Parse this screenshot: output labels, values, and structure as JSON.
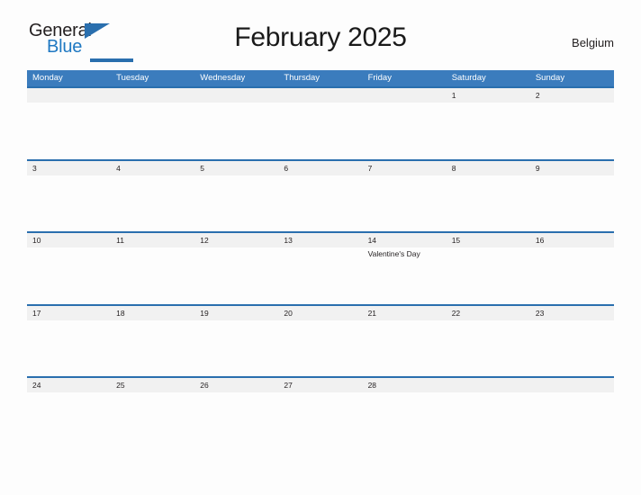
{
  "brand": {
    "name_part1": "General",
    "name_part2": "Blue",
    "flag_icon": "blue-triangle-flag-icon",
    "primary_color": "#2a6fae",
    "accent_color": "#1e78c2",
    "text_color": "#231f20"
  },
  "header": {
    "title": "February 2025",
    "region": "Belgium"
  },
  "colors": {
    "weekday_header_bg": "#3b7cbd",
    "weekday_header_text": "#ffffff",
    "week_rule": "#2a6fae",
    "date_band_bg": "#f1f1f1",
    "page_bg": "#fdfdfd"
  },
  "calendar": {
    "month": "February",
    "year": "2025",
    "weekday_headers": [
      "Monday",
      "Tuesday",
      "Wednesday",
      "Thursday",
      "Friday",
      "Saturday",
      "Sunday"
    ],
    "weeks": [
      {
        "days": [
          {
            "num": "",
            "event": ""
          },
          {
            "num": "",
            "event": ""
          },
          {
            "num": "",
            "event": ""
          },
          {
            "num": "",
            "event": ""
          },
          {
            "num": "",
            "event": ""
          },
          {
            "num": "1",
            "event": ""
          },
          {
            "num": "2",
            "event": ""
          }
        ]
      },
      {
        "days": [
          {
            "num": "3",
            "event": ""
          },
          {
            "num": "4",
            "event": ""
          },
          {
            "num": "5",
            "event": ""
          },
          {
            "num": "6",
            "event": ""
          },
          {
            "num": "7",
            "event": ""
          },
          {
            "num": "8",
            "event": ""
          },
          {
            "num": "9",
            "event": ""
          }
        ]
      },
      {
        "days": [
          {
            "num": "10",
            "event": ""
          },
          {
            "num": "11",
            "event": ""
          },
          {
            "num": "12",
            "event": ""
          },
          {
            "num": "13",
            "event": ""
          },
          {
            "num": "14",
            "event": "Valentine's Day"
          },
          {
            "num": "15",
            "event": ""
          },
          {
            "num": "16",
            "event": ""
          }
        ]
      },
      {
        "days": [
          {
            "num": "17",
            "event": ""
          },
          {
            "num": "18",
            "event": ""
          },
          {
            "num": "19",
            "event": ""
          },
          {
            "num": "20",
            "event": ""
          },
          {
            "num": "21",
            "event": ""
          },
          {
            "num": "22",
            "event": ""
          },
          {
            "num": "23",
            "event": ""
          }
        ]
      },
      {
        "days": [
          {
            "num": "24",
            "event": ""
          },
          {
            "num": "25",
            "event": ""
          },
          {
            "num": "26",
            "event": ""
          },
          {
            "num": "27",
            "event": ""
          },
          {
            "num": "28",
            "event": ""
          },
          {
            "num": "",
            "event": ""
          },
          {
            "num": "",
            "event": ""
          }
        ]
      }
    ]
  }
}
